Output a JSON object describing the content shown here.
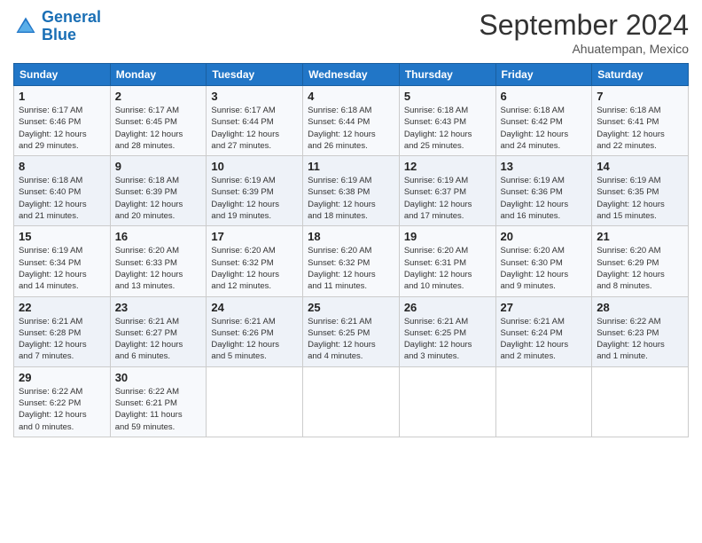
{
  "header": {
    "logo_line1": "General",
    "logo_line2": "Blue",
    "month_title": "September 2024",
    "location": "Ahuatempan, Mexico"
  },
  "weekdays": [
    "Sunday",
    "Monday",
    "Tuesday",
    "Wednesday",
    "Thursday",
    "Friday",
    "Saturday"
  ],
  "weeks": [
    [
      {
        "day": "1",
        "sunrise": "6:17 AM",
        "sunset": "6:46 PM",
        "daylight": "12 hours and 29 minutes."
      },
      {
        "day": "2",
        "sunrise": "6:17 AM",
        "sunset": "6:45 PM",
        "daylight": "12 hours and 28 minutes."
      },
      {
        "day": "3",
        "sunrise": "6:17 AM",
        "sunset": "6:44 PM",
        "daylight": "12 hours and 27 minutes."
      },
      {
        "day": "4",
        "sunrise": "6:18 AM",
        "sunset": "6:44 PM",
        "daylight": "12 hours and 26 minutes."
      },
      {
        "day": "5",
        "sunrise": "6:18 AM",
        "sunset": "6:43 PM",
        "daylight": "12 hours and 25 minutes."
      },
      {
        "day": "6",
        "sunrise": "6:18 AM",
        "sunset": "6:42 PM",
        "daylight": "12 hours and 24 minutes."
      },
      {
        "day": "7",
        "sunrise": "6:18 AM",
        "sunset": "6:41 PM",
        "daylight": "12 hours and 22 minutes."
      }
    ],
    [
      {
        "day": "8",
        "sunrise": "6:18 AM",
        "sunset": "6:40 PM",
        "daylight": "12 hours and 21 minutes."
      },
      {
        "day": "9",
        "sunrise": "6:18 AM",
        "sunset": "6:39 PM",
        "daylight": "12 hours and 20 minutes."
      },
      {
        "day": "10",
        "sunrise": "6:19 AM",
        "sunset": "6:39 PM",
        "daylight": "12 hours and 19 minutes."
      },
      {
        "day": "11",
        "sunrise": "6:19 AM",
        "sunset": "6:38 PM",
        "daylight": "12 hours and 18 minutes."
      },
      {
        "day": "12",
        "sunrise": "6:19 AM",
        "sunset": "6:37 PM",
        "daylight": "12 hours and 17 minutes."
      },
      {
        "day": "13",
        "sunrise": "6:19 AM",
        "sunset": "6:36 PM",
        "daylight": "12 hours and 16 minutes."
      },
      {
        "day": "14",
        "sunrise": "6:19 AM",
        "sunset": "6:35 PM",
        "daylight": "12 hours and 15 minutes."
      }
    ],
    [
      {
        "day": "15",
        "sunrise": "6:19 AM",
        "sunset": "6:34 PM",
        "daylight": "12 hours and 14 minutes."
      },
      {
        "day": "16",
        "sunrise": "6:20 AM",
        "sunset": "6:33 PM",
        "daylight": "12 hours and 13 minutes."
      },
      {
        "day": "17",
        "sunrise": "6:20 AM",
        "sunset": "6:32 PM",
        "daylight": "12 hours and 12 minutes."
      },
      {
        "day": "18",
        "sunrise": "6:20 AM",
        "sunset": "6:32 PM",
        "daylight": "12 hours and 11 minutes."
      },
      {
        "day": "19",
        "sunrise": "6:20 AM",
        "sunset": "6:31 PM",
        "daylight": "12 hours and 10 minutes."
      },
      {
        "day": "20",
        "sunrise": "6:20 AM",
        "sunset": "6:30 PM",
        "daylight": "12 hours and 9 minutes."
      },
      {
        "day": "21",
        "sunrise": "6:20 AM",
        "sunset": "6:29 PM",
        "daylight": "12 hours and 8 minutes."
      }
    ],
    [
      {
        "day": "22",
        "sunrise": "6:21 AM",
        "sunset": "6:28 PM",
        "daylight": "12 hours and 7 minutes."
      },
      {
        "day": "23",
        "sunrise": "6:21 AM",
        "sunset": "6:27 PM",
        "daylight": "12 hours and 6 minutes."
      },
      {
        "day": "24",
        "sunrise": "6:21 AM",
        "sunset": "6:26 PM",
        "daylight": "12 hours and 5 minutes."
      },
      {
        "day": "25",
        "sunrise": "6:21 AM",
        "sunset": "6:25 PM",
        "daylight": "12 hours and 4 minutes."
      },
      {
        "day": "26",
        "sunrise": "6:21 AM",
        "sunset": "6:25 PM",
        "daylight": "12 hours and 3 minutes."
      },
      {
        "day": "27",
        "sunrise": "6:21 AM",
        "sunset": "6:24 PM",
        "daylight": "12 hours and 2 minutes."
      },
      {
        "day": "28",
        "sunrise": "6:22 AM",
        "sunset": "6:23 PM",
        "daylight": "12 hours and 1 minute."
      }
    ],
    [
      {
        "day": "29",
        "sunrise": "6:22 AM",
        "sunset": "6:22 PM",
        "daylight": "12 hours and 0 minutes."
      },
      {
        "day": "30",
        "sunrise": "6:22 AM",
        "sunset": "6:21 PM",
        "daylight": "11 hours and 59 minutes."
      },
      null,
      null,
      null,
      null,
      null
    ]
  ]
}
